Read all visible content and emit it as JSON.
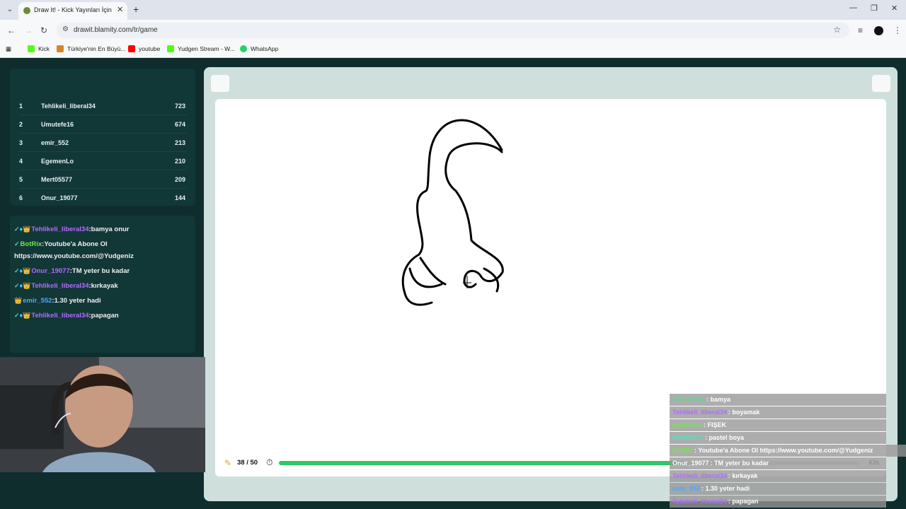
{
  "browser": {
    "tab_title": "Draw It! - Kick Yayınları İçin Çizim",
    "url": "drawit.blamity.com/tr/game",
    "bookmarks": [
      {
        "label": "Kick",
        "color": "#53fc18"
      },
      {
        "label": "Türkiye'nin En Büyü...",
        "color": "#d9822b"
      },
      {
        "label": "youtube",
        "color": "#ff0000"
      },
      {
        "label": "Yudgen Stream - W...",
        "color": "#53fc18"
      },
      {
        "label": "WhatsApp",
        "color": "#25d366"
      }
    ]
  },
  "leaderboard": [
    {
      "rank": "1",
      "name": "Tehlikeli_liberal34",
      "score": "723"
    },
    {
      "rank": "2",
      "name": "Umutefe16",
      "score": "674"
    },
    {
      "rank": "3",
      "name": "emir_552",
      "score": "213"
    },
    {
      "rank": "4",
      "name": "EgemenLo",
      "score": "210"
    },
    {
      "rank": "5",
      "name": "Mert05577",
      "score": "209"
    },
    {
      "rank": "6",
      "name": "Onur_19077",
      "score": "144"
    }
  ],
  "chat": [
    {
      "badges": "✓♦👑",
      "user": "Tehlikeli_liberal34",
      "user_color": "purple",
      "text": ":bamya onur"
    },
    {
      "badges": "✓",
      "user": "BotRix",
      "user_color": "green",
      "text": ":Youtube'a Abone Ol"
    },
    {
      "badges": "",
      "user": "",
      "user_color": "",
      "text": "https://www.youtube.com/@Yudgeniz"
    },
    {
      "badges": "✓♦👑",
      "user": "Onur_19077",
      "user_color": "purple",
      "text": ":TM yeter bu kadar"
    },
    {
      "badges": "✓♦👑",
      "user": "Tehlikeli_liberal34",
      "user_color": "purple",
      "text": ":kırkayak"
    },
    {
      "badges": "👑",
      "user": "emir_552",
      "user_color": "blue",
      "text": ":1.30 yeter hadi"
    },
    {
      "badges": "✓♦👑",
      "user": "Tehlikeli_liberal34",
      "user_color": "purple",
      "text": ":papagan"
    }
  ],
  "game": {
    "round": "38 / 50",
    "progress": 0.7,
    "timer": "63s",
    "pen_icon": "pencil-icon",
    "clock_icon": "clock-icon"
  },
  "overlay": [
    {
      "user": "Umutefe16",
      "color": "#54e08a",
      "text": ": bamya"
    },
    {
      "user": "Tehlikeli_liberal34",
      "color": "#b36cff",
      "text": ": boyamak"
    },
    {
      "user": "plpkcihan",
      "color": "#6ee84b",
      "text": ": FIŞEK"
    },
    {
      "user": "Mert05577",
      "color": "#54e0c0",
      "text": ": pastel boya"
    },
    {
      "user": "BotRix",
      "color": "#6ee84b",
      "text": ": Youtube'a Abone Ol https://www.youtube.com/@Yudgeniz"
    },
    {
      "user": "Onur_19077",
      "color": "#ffffff",
      "text": ": TM yeter bu kadar"
    },
    {
      "user": "Tehlikeli_liberal34",
      "color": "#b36cff",
      "text": ": kırkayak"
    },
    {
      "user": "emir_552",
      "color": "#4ea6ff",
      "text": ": 1.30 yeter hadi"
    },
    {
      "user": "Tehlikeli_liberal34",
      "color": "#b36cff",
      "text": ": papagan"
    }
  ]
}
